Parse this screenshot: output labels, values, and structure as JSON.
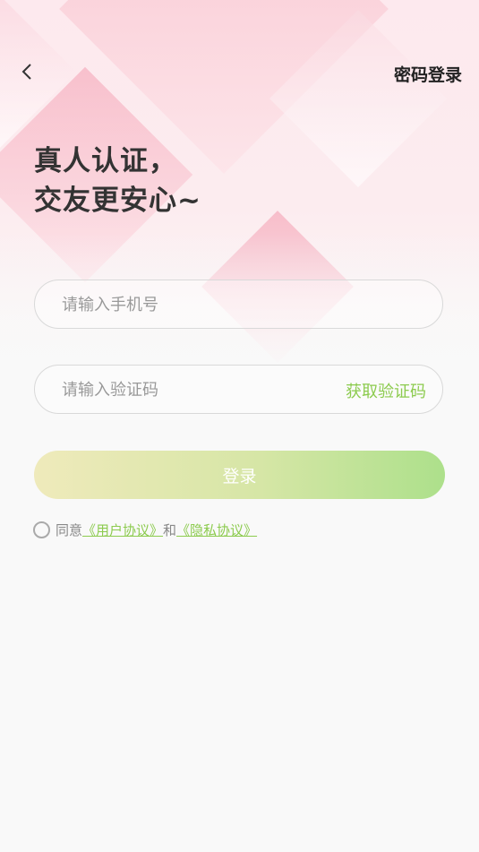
{
  "header": {
    "back_icon": "chevron-left-icon",
    "password_login": "密码登录"
  },
  "headline": {
    "line1": "真人认证，",
    "line2": "交友更安心~"
  },
  "form": {
    "phone_placeholder": "请输入手机号",
    "code_placeholder": "请输入验证码",
    "get_code": "获取验证码",
    "login": "登录"
  },
  "agreement": {
    "prefix": "同意",
    "user_link": "《用户协议》",
    "and": "和",
    "privacy_link": "《隐私协议》"
  },
  "colors": {
    "accent": "#8ccb4e",
    "hero_pink": "#f7b9c6",
    "button_start": "#efeabb",
    "button_end": "#ade08b"
  }
}
